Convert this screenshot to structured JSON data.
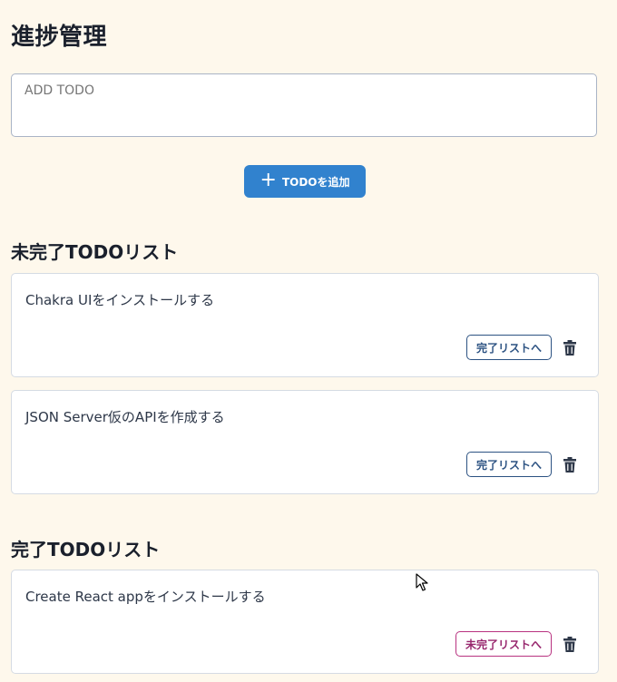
{
  "page": {
    "title": "進捗管理"
  },
  "input": {
    "placeholder": "ADD TODO"
  },
  "add_button": {
    "label": "TODOを追加",
    "icon": "plus-icon"
  },
  "incomplete": {
    "heading": "未完了TODOリスト",
    "items": [
      {
        "text": "Chakra UIをインストールする",
        "action_label": "完了リストへ"
      },
      {
        "text": "JSON Server仮のAPIを作成する",
        "action_label": "完了リストへ"
      }
    ]
  },
  "complete": {
    "heading": "完了TODOリスト",
    "items": [
      {
        "text": "Create React appをインストールする",
        "action_label": "未完了リストへ"
      }
    ]
  },
  "colors": {
    "background": "#fef8ec",
    "accent": "#3182ce",
    "incomplete_action": "#2c5282",
    "complete_action": "#b83280"
  }
}
